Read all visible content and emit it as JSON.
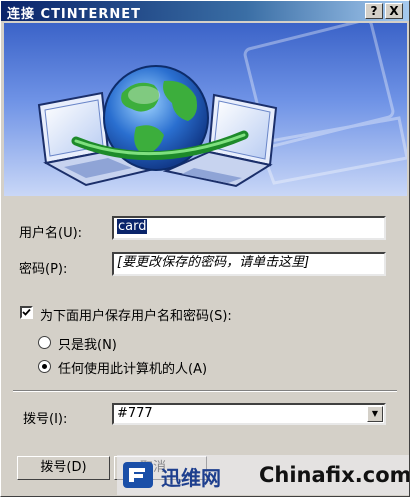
{
  "window": {
    "title": "连接 CTINTERNET",
    "help_glyph": "?",
    "close_glyph": "X"
  },
  "form": {
    "username_label": "用户名(U):",
    "username_value": "card",
    "password_label": "密码(P):",
    "password_value": "[要更改保存的密码，请单击这里]",
    "save_checkbox_label": "为下面用户保存用户名和密码(S):",
    "save_checked": true,
    "radio_only_me": "只是我(N)",
    "radio_anyone": "任何使用此计算机的人(A)",
    "selected_radio": "anyone",
    "dial_label": "拨号(I):",
    "dial_value": "#777"
  },
  "buttons": {
    "dial": "拨号(D)",
    "cancel_partial": "取消"
  },
  "watermark": {
    "brand_cn": "迅维网",
    "site": "Chinafix.com"
  },
  "colors": {
    "dialog_bg": "#d4d0c8",
    "title_start": "#0a246a",
    "title_end": "#a6caf0",
    "banner_blue": "#4f78d8",
    "globe_green": "#2f9a3c"
  }
}
